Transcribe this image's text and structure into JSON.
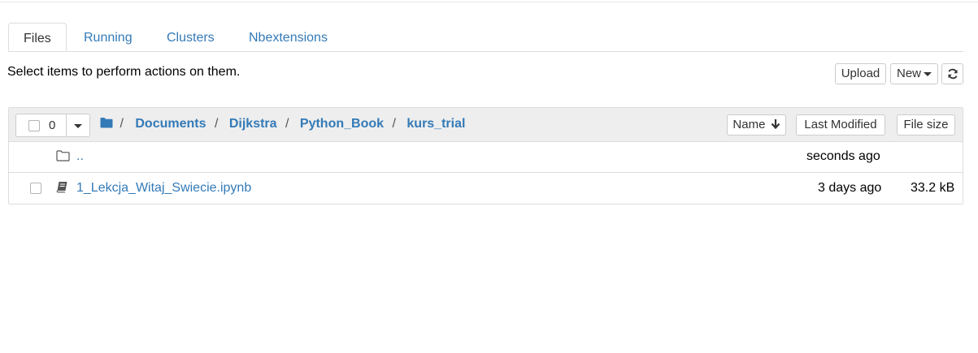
{
  "tabs": [
    {
      "label": "Files",
      "active": true
    },
    {
      "label": "Running",
      "active": false
    },
    {
      "label": "Clusters",
      "active": false
    },
    {
      "label": "Nbextensions",
      "active": false
    }
  ],
  "hint_text": "Select items to perform actions on them.",
  "toolbar": {
    "upload_label": "Upload",
    "new_label": "New",
    "refresh_icon": "refresh-icon"
  },
  "list_header": {
    "selected_count": "0",
    "folder_icon": "folder-icon",
    "breadcrumb": [
      {
        "label": "Documents"
      },
      {
        "label": "Dijkstra"
      },
      {
        "label": "Python_Book"
      },
      {
        "label": "kurs_trial"
      }
    ],
    "separator": "/",
    "sort_name_label": "Name",
    "sort_modified_label": "Last Modified",
    "sort_size_label": "File size"
  },
  "items": [
    {
      "icon": "folder-outline-icon",
      "name": "..",
      "modified": "seconds ago",
      "size": ""
    },
    {
      "icon": "notebook-icon",
      "name": "1_Lekcja_Witaj_Swiecie.ipynb",
      "modified": "3 days ago",
      "size": "33.2 kB"
    }
  ],
  "colors": {
    "link": "#337ab7",
    "header_bg": "#eeeeee",
    "border": "#dddddd"
  }
}
